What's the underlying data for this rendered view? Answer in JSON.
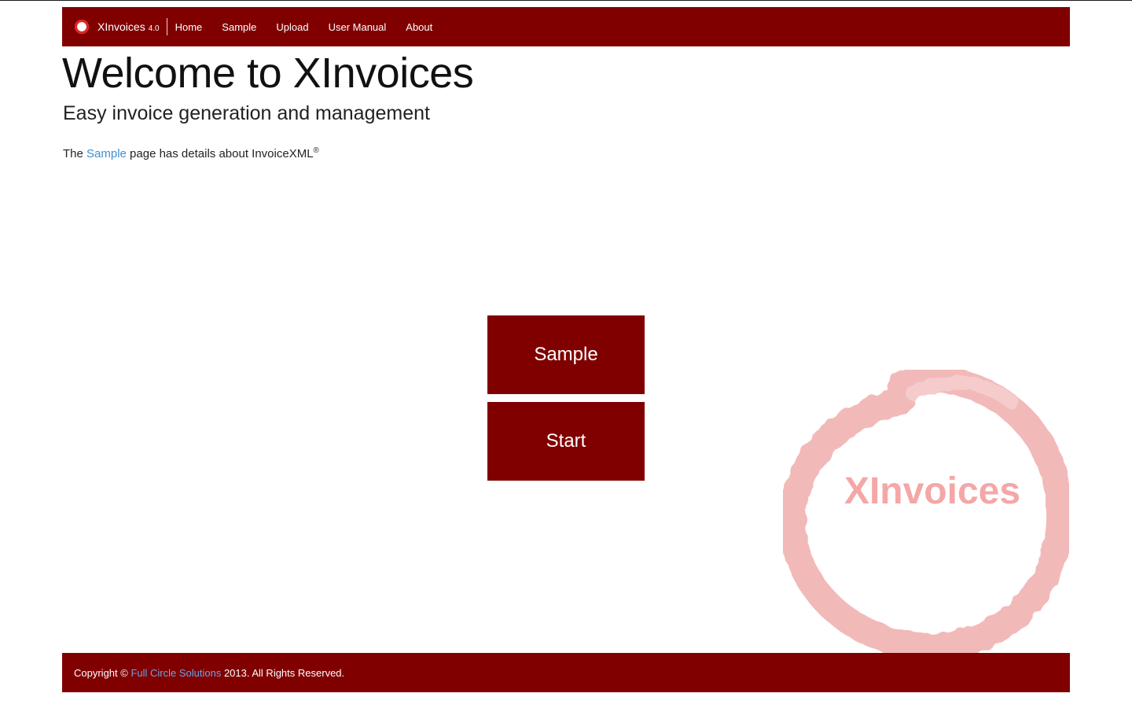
{
  "brand": {
    "name": "XInvoices",
    "version": "4.0",
    "logo_icon": "red-circle-logo-icon",
    "color": "#800000"
  },
  "nav": {
    "items": [
      {
        "label": "Home"
      },
      {
        "label": "Sample"
      },
      {
        "label": "Upload"
      },
      {
        "label": "User Manual"
      },
      {
        "label": "About"
      }
    ]
  },
  "hero": {
    "title": "Welcome to XInvoices",
    "subtitle": "Easy invoice generation and management"
  },
  "intro": {
    "prefix": "The ",
    "link": "Sample",
    "suffix": " page has details about InvoiceXML",
    "mark": "®"
  },
  "tiles": {
    "sample_label": "Sample",
    "start_label": "Start"
  },
  "watermark": {
    "text": "XInvoices",
    "color": "#f4a7a7"
  },
  "footer": {
    "prefix": "Copyright © ",
    "link": "Full Circle Solutions",
    "suffix": " 2013. All Rights Reserved."
  }
}
